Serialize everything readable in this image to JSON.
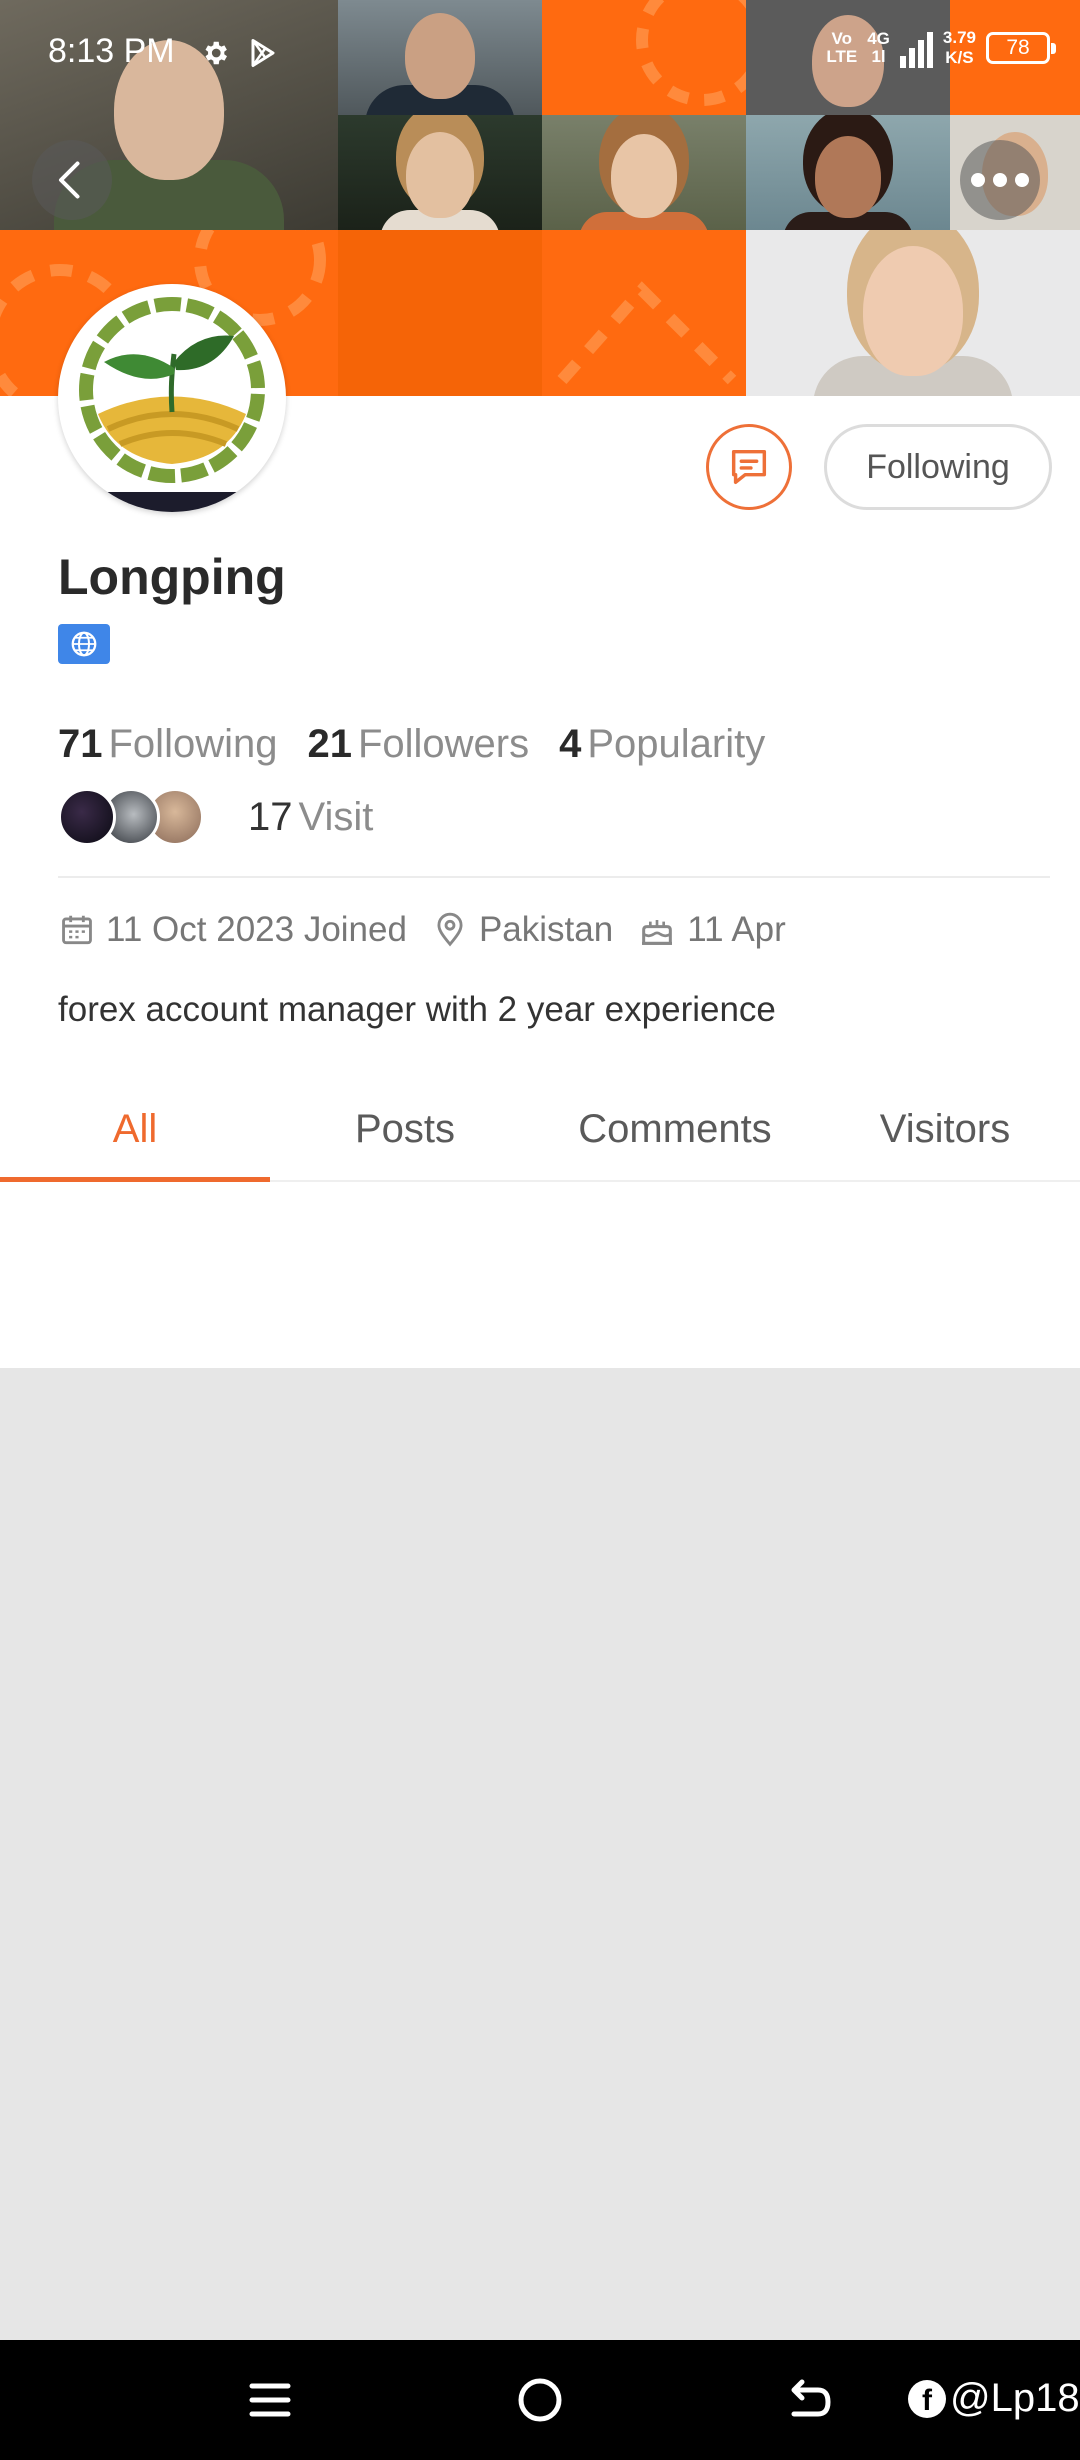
{
  "status_bar": {
    "time": "8:13 PM",
    "network_top": "Vo",
    "network_bottom": "LTE",
    "signal_type_top": "4G",
    "signal_type_bottom": "1l",
    "speed_value": "3.79",
    "speed_unit": "K/S",
    "battery": "78"
  },
  "profile": {
    "name": "Longping",
    "follow_button": "Following",
    "stats": [
      {
        "value": "71",
        "label": "Following"
      },
      {
        "value": "21",
        "label": "Followers"
      },
      {
        "value": "4",
        "label": "Popularity"
      }
    ],
    "visit_count": "17",
    "visit_label": "Visit",
    "joined": "11 Oct 2023 Joined",
    "location": "Pakistan",
    "birthday": "11 Apr",
    "bio": "forex account manager with 2 year experience"
  },
  "tabs": [
    {
      "label": "All",
      "active": true
    },
    {
      "label": "Posts",
      "active": false
    },
    {
      "label": "Comments",
      "active": false
    },
    {
      "label": "Visitors",
      "active": false
    }
  ],
  "colors": {
    "accent": "#ef6a2e",
    "banner_orange": "#ff6a10",
    "badge_blue": "#3f86e8"
  },
  "watermark": "@Lp18",
  "icons": [
    "back-icon",
    "more-icon",
    "message-icon",
    "globe-icon",
    "calendar-icon",
    "location-icon",
    "cake-icon",
    "gear-icon",
    "play-store-icon"
  ]
}
